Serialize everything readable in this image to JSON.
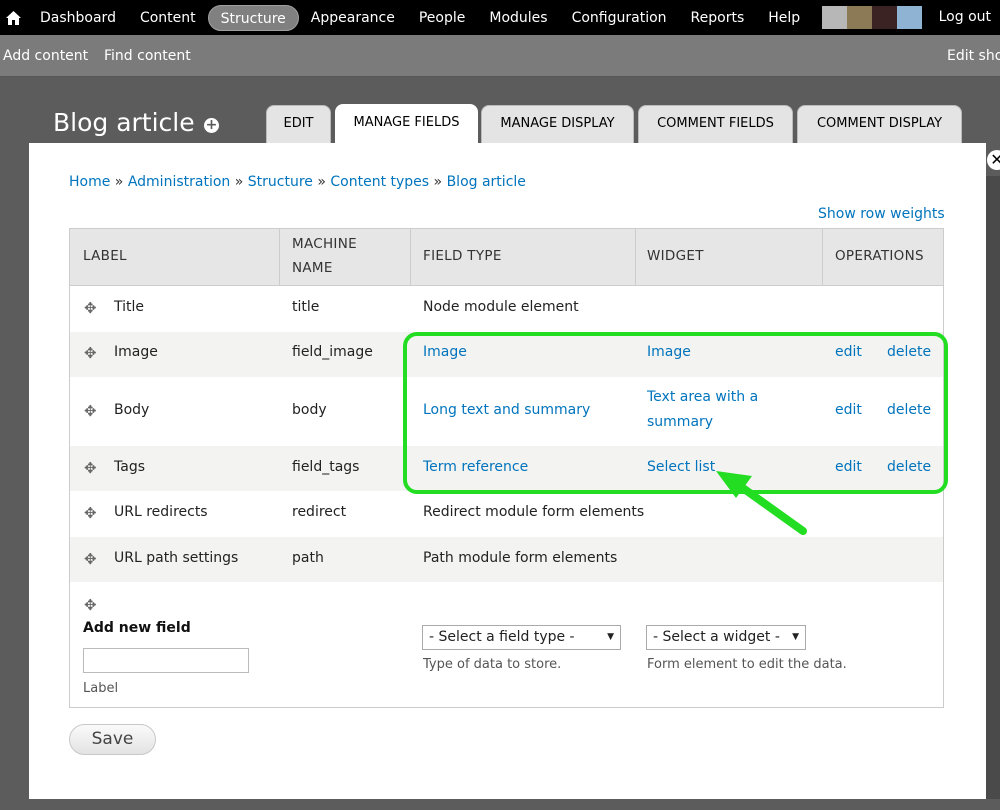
{
  "toolbar": {
    "home_icon": "home-icon",
    "items": [
      {
        "label": "Dashboard",
        "x": 0
      },
      {
        "label": "Content"
      },
      {
        "label": "Structure",
        "active": true
      },
      {
        "label": "Appearance"
      },
      {
        "label": "People"
      },
      {
        "label": "Modules"
      },
      {
        "label": "Configuration"
      },
      {
        "label": "Reports"
      },
      {
        "label": "Help"
      }
    ],
    "swatch_colors": [
      "#b7b7b7",
      "#8c7a57",
      "#3a2322",
      "#8fb3d2"
    ],
    "logout": "Log out"
  },
  "shortcuts": {
    "add_content": "Add content",
    "find_content": "Find content",
    "edit_shortcuts": "Edit sho"
  },
  "page": {
    "title": "Blog article",
    "tabs": [
      "EDIT",
      "MANAGE FIELDS",
      "MANAGE DISPLAY",
      "COMMENT FIELDS",
      "COMMENT DISPLAY"
    ],
    "active_tab": "MANAGE FIELDS"
  },
  "breadcrumb": {
    "items": [
      "Home",
      "Administration",
      "Structure",
      "Content types",
      "Blog article"
    ],
    "separator": "»"
  },
  "show_row_weights": "Show row weights",
  "table": {
    "headers": {
      "label": "LABEL",
      "machine_name_1": "MACHINE",
      "machine_name_2": "NAME",
      "field_type": "FIELD TYPE",
      "widget": "WIDGET",
      "operations": "OPERATIONS"
    },
    "rows": [
      {
        "label": "Title",
        "machine": "title",
        "type": "Node module element",
        "type_link": false,
        "widget": "",
        "widget2": "",
        "edit": "",
        "delete": ""
      },
      {
        "label": "Image",
        "machine": "field_image",
        "type": "Image",
        "type_link": true,
        "widget": "Image",
        "widget2": "",
        "edit": "edit",
        "delete": "delete"
      },
      {
        "label": "Body",
        "machine": "body",
        "type": "Long text and summary",
        "type_link": true,
        "widget": "Text area with a",
        "widget2": "summary",
        "edit": "edit",
        "delete": "delete"
      },
      {
        "label": "Tags",
        "machine": "field_tags",
        "type": "Term reference",
        "type_link": true,
        "widget": "Select list",
        "widget2": "",
        "edit": "edit",
        "delete": "delete"
      },
      {
        "label": "URL redirects",
        "machine": "redirect",
        "type": "Redirect module form elements",
        "type_link": false,
        "widget": "",
        "widget2": "",
        "edit": "",
        "delete": ""
      },
      {
        "label": "URL path settings",
        "machine": "path",
        "type": "Path module form elements",
        "type_link": false,
        "widget": "",
        "widget2": "",
        "edit": "",
        "delete": ""
      }
    ],
    "new_field": {
      "heading": "Add new field",
      "label_value": "",
      "label_caption": "Label",
      "type_select": "- Select a field type -",
      "type_desc": "Type of data to store.",
      "widget_select": "- Select a widget -",
      "widget_desc": "Form element to edit the data."
    }
  },
  "save_label": "Save",
  "close_icon": "close-icon",
  "highlight_color": "#22dd22"
}
